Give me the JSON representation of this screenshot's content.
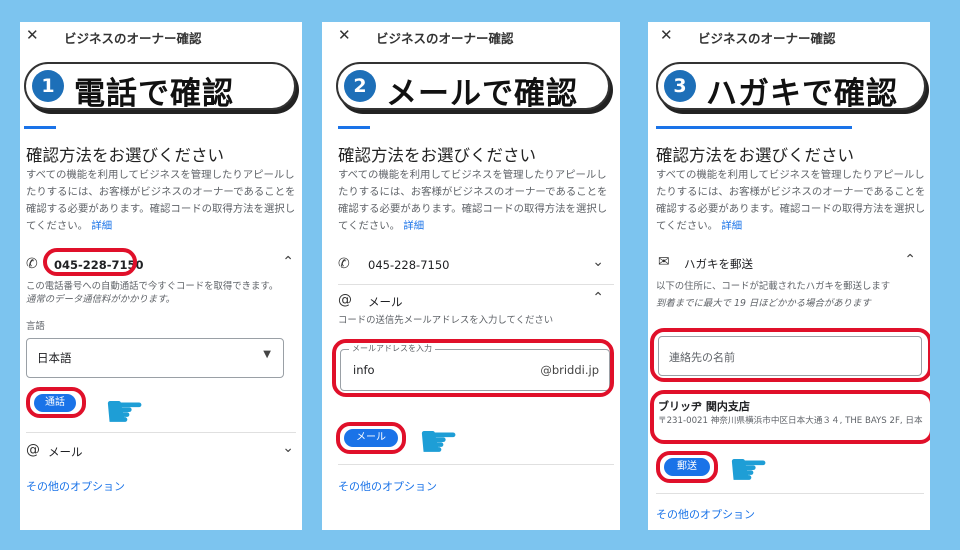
{
  "header": {
    "close_icon": "✕",
    "title": "ビジネスのオーナー確認"
  },
  "common": {
    "heading": "確認方法をお選びください",
    "desc": "すべての機能を利用してビジネスを管理したりアピールしたりするには、お客様がビジネスのオーナーであることを確認する必要があります。確認コードの取得方法を選択してください。",
    "detail_link": "詳細",
    "other_options": "その他のオプション"
  },
  "panel1": {
    "badge": "1",
    "banner": "電話で確認",
    "phone": "045-228-7150",
    "phone_note": "この電話番号への自動通話で今すぐコードを取得できます。",
    "phone_note2": "通常のデータ通信料がかかります。",
    "lang_label": "言語",
    "lang_value": "日本語",
    "call_button": "通話",
    "mail_label": "メール"
  },
  "panel2": {
    "badge": "2",
    "banner": "メールで確認",
    "phone": "045-228-7150",
    "mail_label": "メール",
    "mail_note": "コードの送信先メールアドレスを入力してください",
    "email_field_label": "メールアドレスを入力",
    "email_local": "info",
    "email_domain": "@briddi.jp",
    "mail_button": "メール"
  },
  "panel3": {
    "badge": "3",
    "banner": "ハガキで確認",
    "postcard_label": "ハガキを郵送",
    "postcard_note": "以下の住所に、コードが記載されたハガキを郵送します",
    "postcard_note2": "到着までに最大で 19 日ほどかかる場合があります",
    "contact_placeholder": "連絡先の名前",
    "business_name": "ブリッヂ 関内支店",
    "address": "〒231-0021 神奈川県横浜市中区日本大通３４, THE BAYS 2F, 日本",
    "send_button": "郵送"
  },
  "colors": {
    "accent": "#1a73e8",
    "highlight": "#e0102a",
    "background": "#7cc4ef",
    "badge": "#1d6fb8"
  },
  "icons": {
    "phone": "phone-icon",
    "mail": "at-icon",
    "envelope": "envelope-icon",
    "chevron_up": "chevron-up-icon",
    "chevron_down": "chevron-down-icon",
    "pointer": "pointing-hand-icon"
  }
}
